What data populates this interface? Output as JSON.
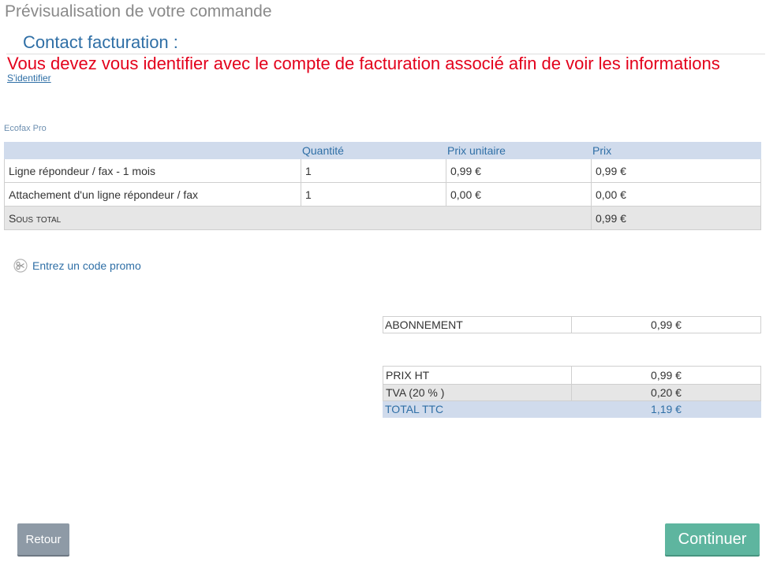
{
  "page": {
    "title": "Prévisualisation de votre commande",
    "contact_title": "Contact facturation :",
    "auth_warning": "Vous devez vous identifier avec le compte de facturation associé afin de voir les informations",
    "login_link": "S'identifier",
    "product_name": "Ecofax Pro"
  },
  "order_table": {
    "headers": [
      "",
      "Quantité",
      "Prix unitaire",
      "Prix"
    ],
    "rows": [
      {
        "item": "Ligne répondeur / fax - 1 mois",
        "quantity": "1",
        "unit_price": "0,99 €",
        "price": "0,99 €"
      },
      {
        "item": "Attachement d'un ligne répondeur / fax",
        "quantity": "1",
        "unit_price": "0,00 €",
        "price": "0,00 €"
      }
    ],
    "subtotal_label": "Sous total",
    "subtotal_value": "0,99 €"
  },
  "promo": {
    "label": "Entrez un code promo",
    "icon": "scissors-icon"
  },
  "subscription": {
    "label": "ABONNEMENT",
    "value": "0,99 €"
  },
  "summary": {
    "ht_label": "PRIX HT",
    "ht_value": "0,99 €",
    "tva_label": "TVA (20 % )",
    "tva_value": "0,20 €",
    "ttc_label": "TOTAL TTC",
    "ttc_value": "1,19 €"
  },
  "buttons": {
    "back": "Retour",
    "continue": "Continuer"
  },
  "colors": {
    "accent": "#2f6fa6",
    "warning": "#e3001b",
    "header_bg": "#d0dbec",
    "continue_bg": "#5eb59f",
    "back_bg": "#8e9aa6"
  }
}
